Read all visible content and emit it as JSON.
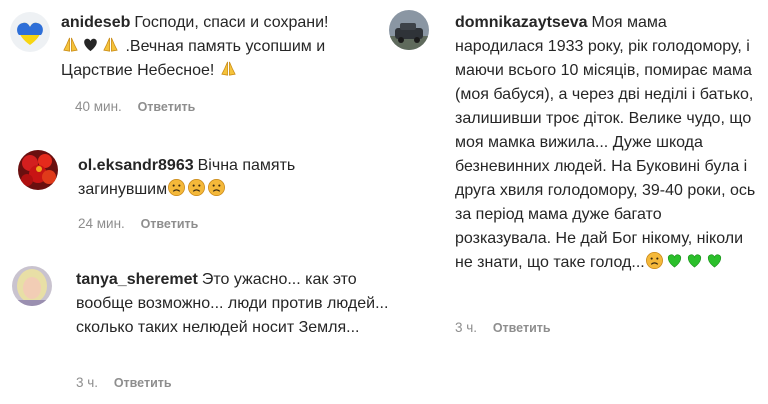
{
  "comments": [
    {
      "username": "anideseb",
      "text_parts": [
        "Господи, спаси и сохрани! ",
        "pray",
        "heart",
        "pray",
        " .Вечная память усопшим и Царствие Небесное! ",
        "pray"
      ],
      "time": "40 мин.",
      "reply": "Ответить",
      "avatar": "heart-avatar"
    },
    {
      "username": "ol.eksandr8963",
      "text_parts": [
        "Вічна память загинувшим",
        "sad",
        "sad",
        "sad"
      ],
      "time": "24 мин.",
      "reply": "Ответить",
      "avatar": "flowers-avatar"
    },
    {
      "username": "tanya_sheremet",
      "text_parts": [
        "Это ужасно... как это вообще возможно... люди против людей... сколько таких нелюдей носит Земля..."
      ],
      "time": "3 ч.",
      "reply": "Ответить",
      "avatar": "woman-avatar"
    },
    {
      "username": "domnikazaytseva",
      "text_parts": [
        "Моя мама народилася 1933 року, рік голодомору, і маючи всього 10 місяців, помирає мама (моя бабуся), а через дві неділі і батько, залишивши троє діток. Велике чудо, що моя мамка вижила... Дуже шкода безневинних людей. На Буковині була і друга хвиля голодомору, 39-40 роки, ось за період мама дуже багато розказувала. Не дай Бог нікому, ніколи не знати, що таке голод...",
        "sad",
        "green-heart",
        "green-heart",
        "green-heart"
      ],
      "time": "3 ч.",
      "reply": "Ответить",
      "avatar": "car-avatar"
    }
  ],
  "colors": {
    "text": "#262626",
    "meta": "#8e8e8e",
    "pray": "#f5c33b",
    "heart": "#262626",
    "green_heart": "#2bbf2b",
    "sad": "#f4b83a"
  }
}
